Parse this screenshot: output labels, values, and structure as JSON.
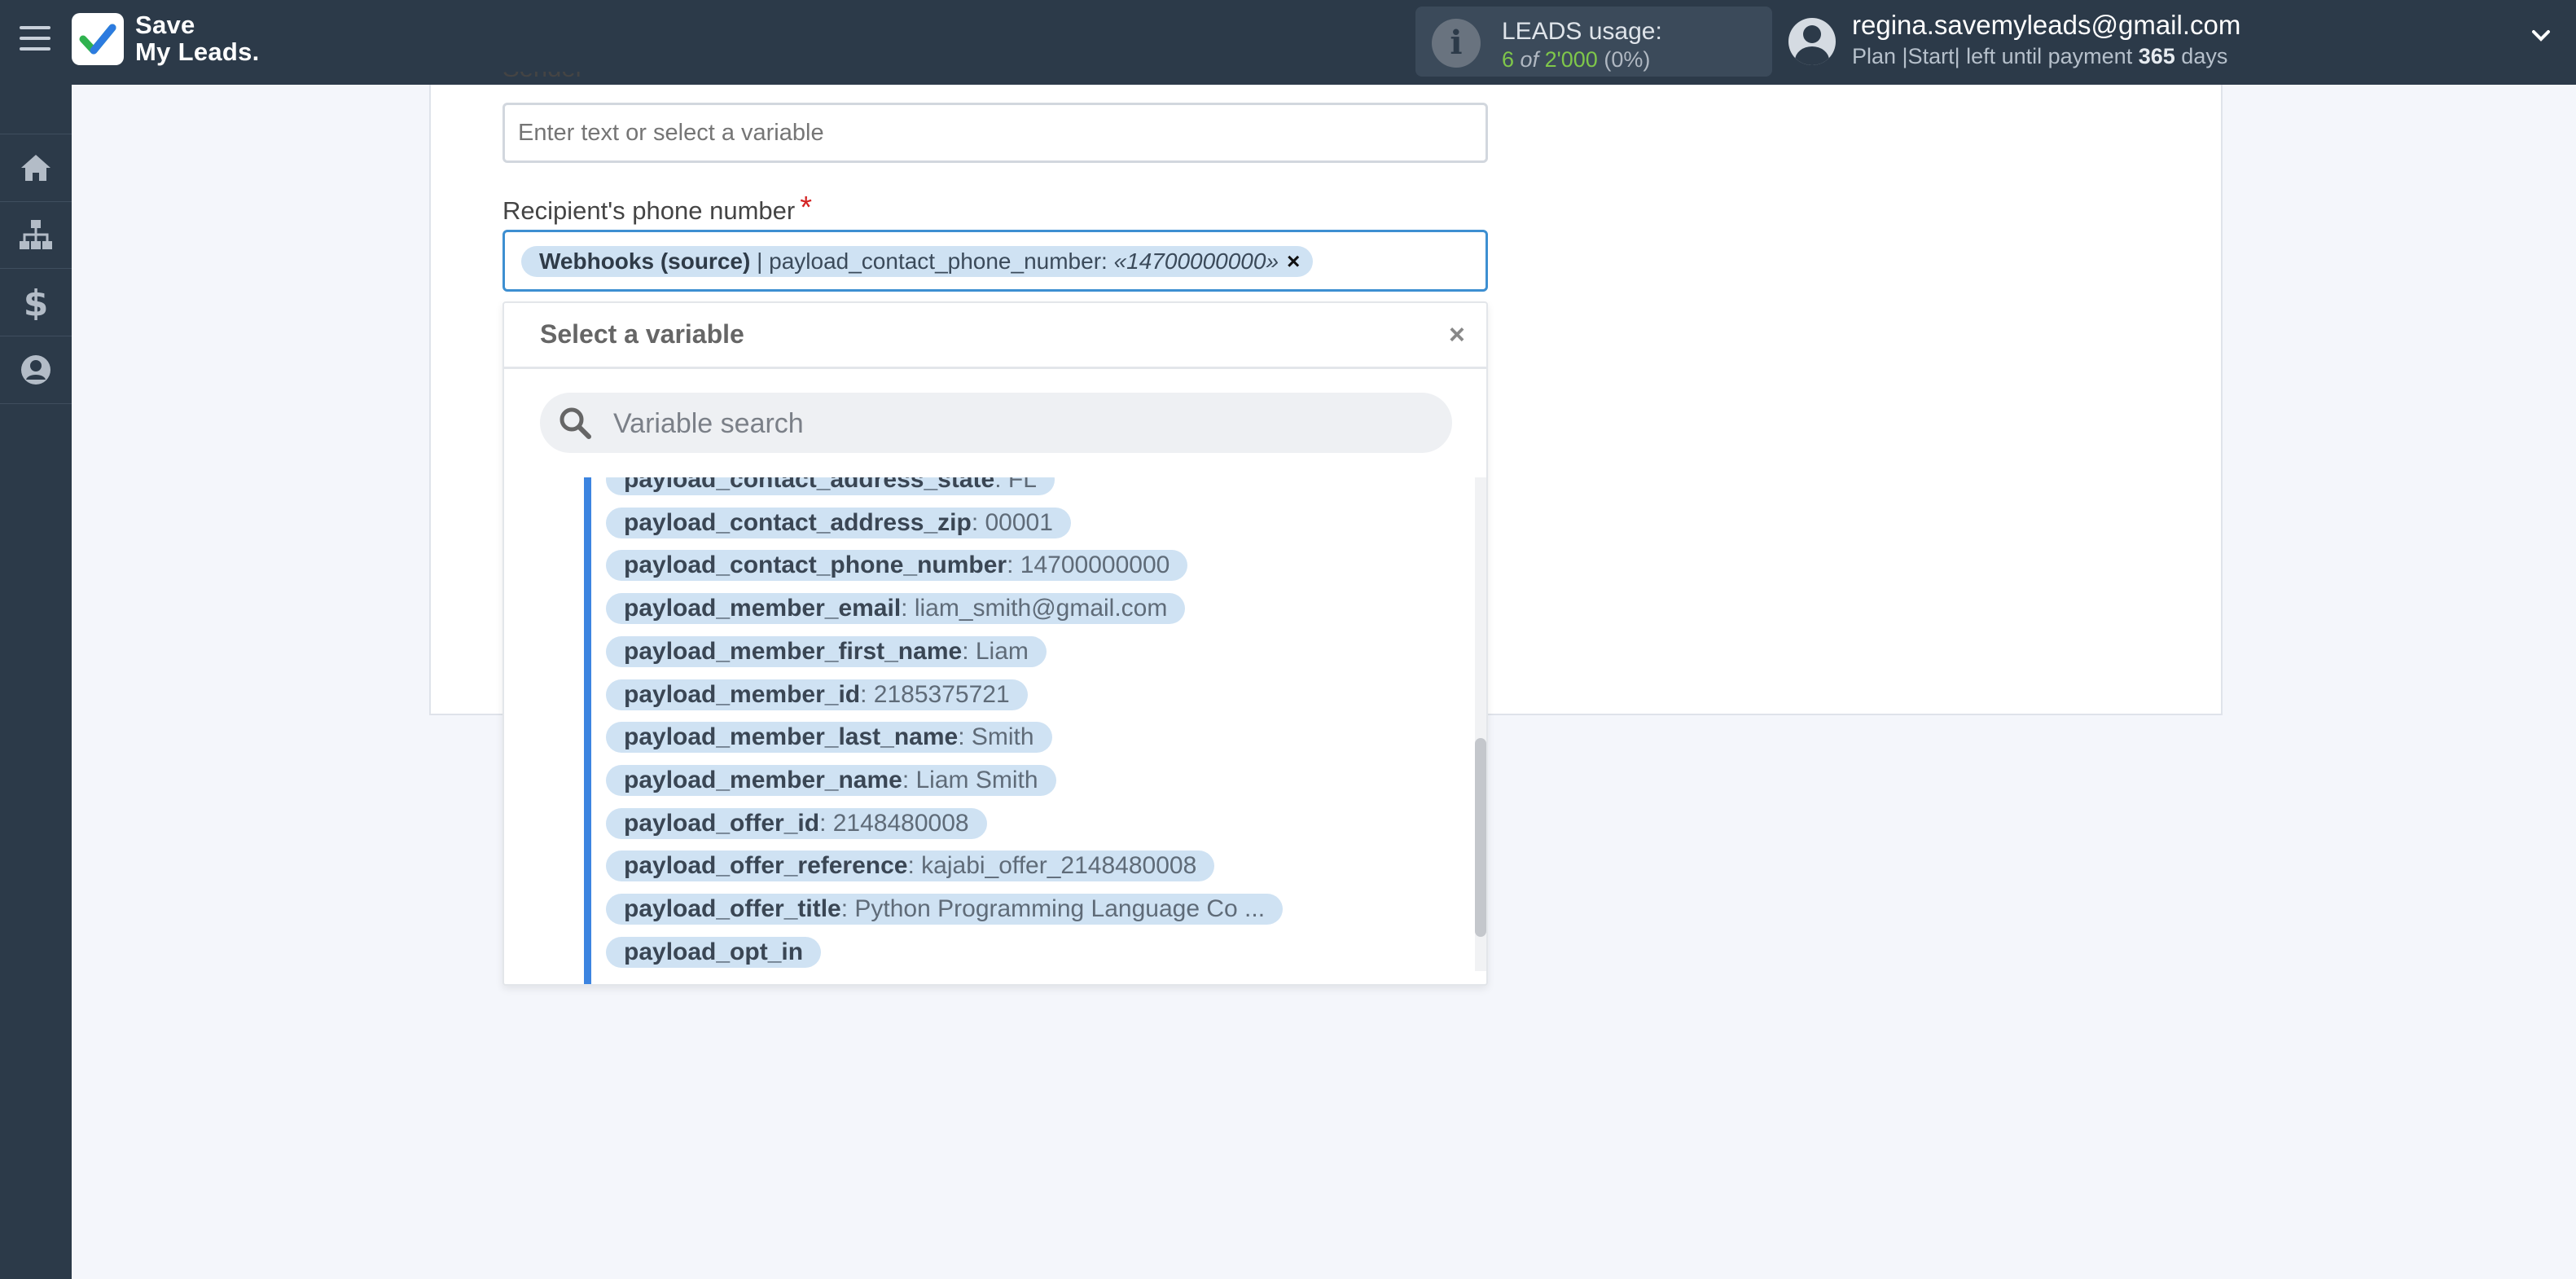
{
  "header": {
    "logo_line1": "Save",
    "logo_line2": "My Leads.",
    "usage": {
      "title": "LEADS usage:",
      "used": "6",
      "of_label": "of",
      "total": "2'000",
      "percent": "(0%)"
    },
    "user": {
      "email": "regina.savemyleads@gmail.com",
      "plan_text": "Plan |Start| left until payment",
      "days": "365",
      "days_unit": "days"
    }
  },
  "sidebar": {
    "items": [
      {
        "icon": "home-icon"
      },
      {
        "icon": "sitemap-icon"
      },
      {
        "icon": "dollar-icon"
      },
      {
        "icon": "user-circle-icon"
      }
    ]
  },
  "form": {
    "sender_label": "Sender",
    "sender_placeholder": "Enter text or select a variable",
    "phone_label": "Recipient's phone number",
    "phone_required": "*",
    "phone_chip": {
      "source": "Webhooks (source)",
      "separator": " | payload_contact_phone_number: ",
      "value": "«14700000000»",
      "remove": "×"
    }
  },
  "dropdown": {
    "title": "Select a variable",
    "close": "×",
    "search_placeholder": "Variable search",
    "variables": [
      {
        "name": "payload_contact_address_state",
        "value": ": FL"
      },
      {
        "name": "payload_contact_address_zip",
        "value": ": 00001"
      },
      {
        "name": "payload_contact_phone_number",
        "value": ": 14700000000"
      },
      {
        "name": "payload_member_email",
        "value": ": liam_smith@gmail.com"
      },
      {
        "name": "payload_member_first_name",
        "value": ": Liam"
      },
      {
        "name": "payload_member_id",
        "value": ": 2185375721"
      },
      {
        "name": "payload_member_last_name",
        "value": ": Smith"
      },
      {
        "name": "payload_member_name",
        "value": ": Liam Smith"
      },
      {
        "name": "payload_offer_id",
        "value": ": 2148480008"
      },
      {
        "name": "payload_offer_reference",
        "value": ": kajabi_offer_2148480008"
      },
      {
        "name": "payload_offer_title",
        "value": ": Python Programming Language Co ..."
      },
      {
        "name": "payload_opt_in",
        "value": ""
      }
    ]
  },
  "colors": {
    "topbar": "#2c3a49",
    "accent_blue": "#3d8fd1",
    "chip_bg": "#cfe2f3",
    "usage_green": "#7fc74a",
    "required_red": "#d42424"
  }
}
